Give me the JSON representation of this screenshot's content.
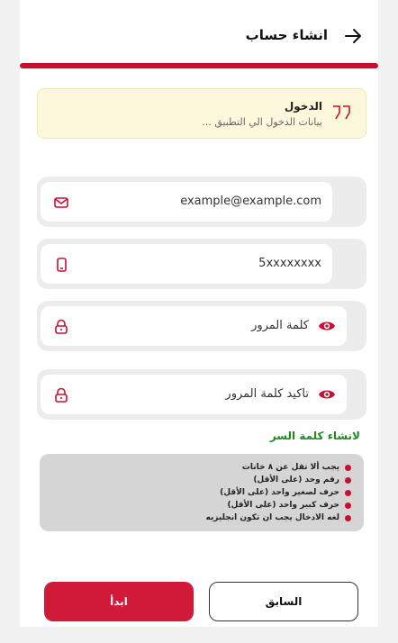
{
  "header": {
    "title": "انشاء حساب"
  },
  "info_card": {
    "title": "الدخول",
    "subtitle": "بيانات الدخول الي التطبيق ..."
  },
  "email_field": {
    "value": "example@example.com",
    "icon": "mail-icon"
  },
  "phone_field": {
    "value": "5xxxxxxxx",
    "icon": "phone-icon"
  },
  "password_field": {
    "placeholder": "كلمة المرور",
    "icon": "lock-icon"
  },
  "confirm_password_field": {
    "placeholder": "تاكيد كلمة المرور",
    "icon": "lock-icon"
  },
  "password_rules": {
    "title": "لانشاء كلمة السر",
    "items": [
      "يجب ألا تقل عن ٨ خانات",
      "رقم وحد (على الأقل)",
      "حرف لصغير واحد (على الأقل)",
      "حرف كبير واحد (على الأقل)",
      "لغه الادخال يجب ان تكون انجليزيه"
    ]
  },
  "buttons": {
    "start": "ابدأ",
    "previous": "السابق"
  },
  "colors": {
    "accent": "#c8102e",
    "rules_title": "#1f8a1f",
    "info_bg": "#fdf7dc"
  }
}
